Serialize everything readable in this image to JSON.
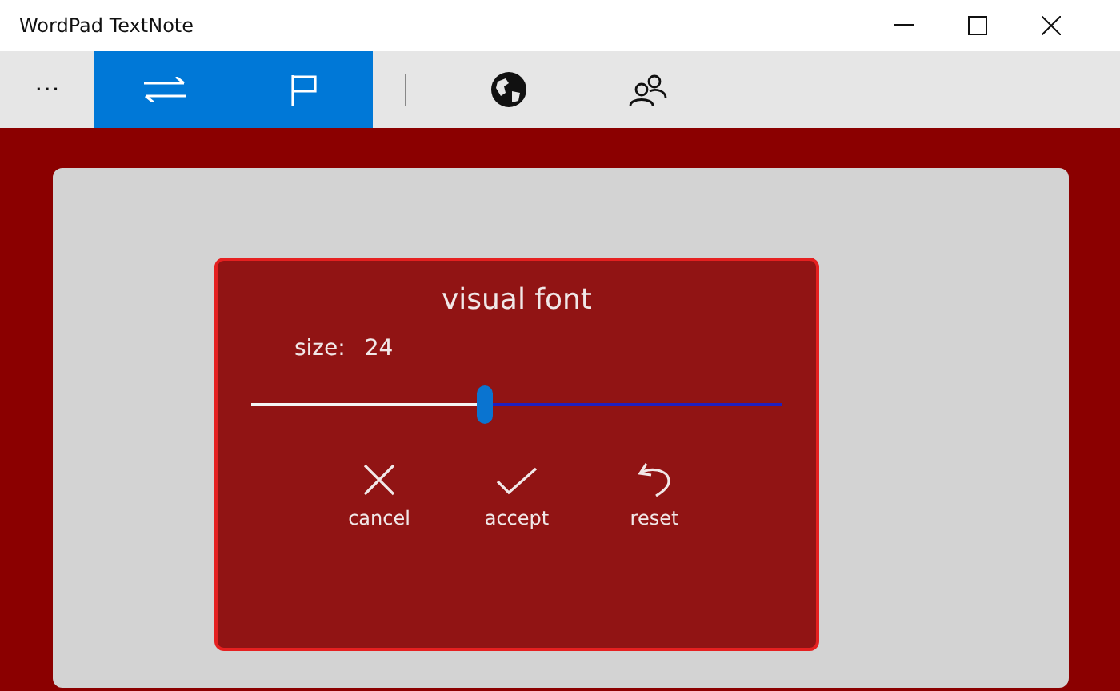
{
  "window": {
    "title": "WordPad TextNote"
  },
  "toolbar": [
    {
      "kind": "more",
      "label": "···",
      "selected": false
    },
    {
      "kind": "swap",
      "selected": true
    },
    {
      "kind": "flag",
      "selected": true
    },
    {
      "kind": "separator"
    },
    {
      "kind": "globe",
      "selected": false
    },
    {
      "kind": "people",
      "selected": false
    }
  ],
  "dialog": {
    "title": "visual font",
    "size_label": "size:",
    "size_value": "24",
    "slider": {
      "level": 0.44
    },
    "actions": [
      {
        "kind": "cancel",
        "label": "cancel"
      },
      {
        "kind": "accept",
        "label": "accept"
      },
      {
        "kind": "reset",
        "label": "reset"
      }
    ]
  }
}
